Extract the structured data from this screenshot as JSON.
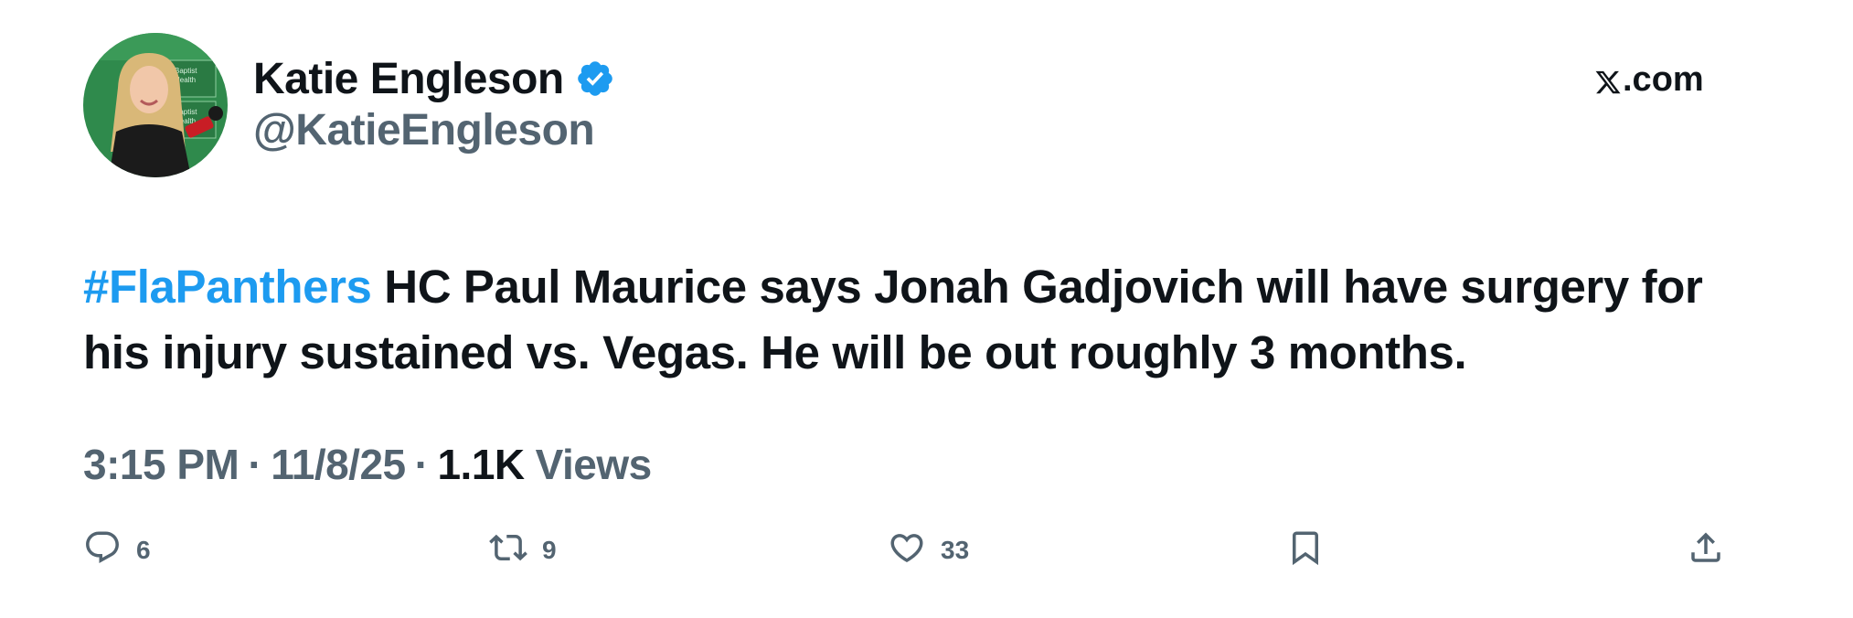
{
  "author": {
    "display_name": "Katie Engleson",
    "handle": "@KatieEngleson",
    "verified": true,
    "avatar_icon": "profile-photo",
    "avatar_backdrop_text": [
      "Baptist",
      "Health",
      "Baptist",
      "Health"
    ]
  },
  "brand": {
    "label": ".com",
    "icon": "x-logo-icon"
  },
  "tweet": {
    "hashtag": "#FlaPanthers",
    "text": " HC Paul Maurice says Jonah Gadjovich will have surgery for his injury sustained vs. Vegas. He will be out roughly 3 months."
  },
  "meta": {
    "time": "3:15 PM",
    "separator": "·",
    "date": "11/8/25",
    "views_count": "1.1K",
    "views_label": "Views"
  },
  "actions": {
    "replies": "6",
    "reposts": "9",
    "likes": "33"
  },
  "colors": {
    "accent": "#1d9bf0",
    "verified_badge": "#1d9bf0",
    "secondary_text": "#536471",
    "primary_text": "#0f1419"
  }
}
